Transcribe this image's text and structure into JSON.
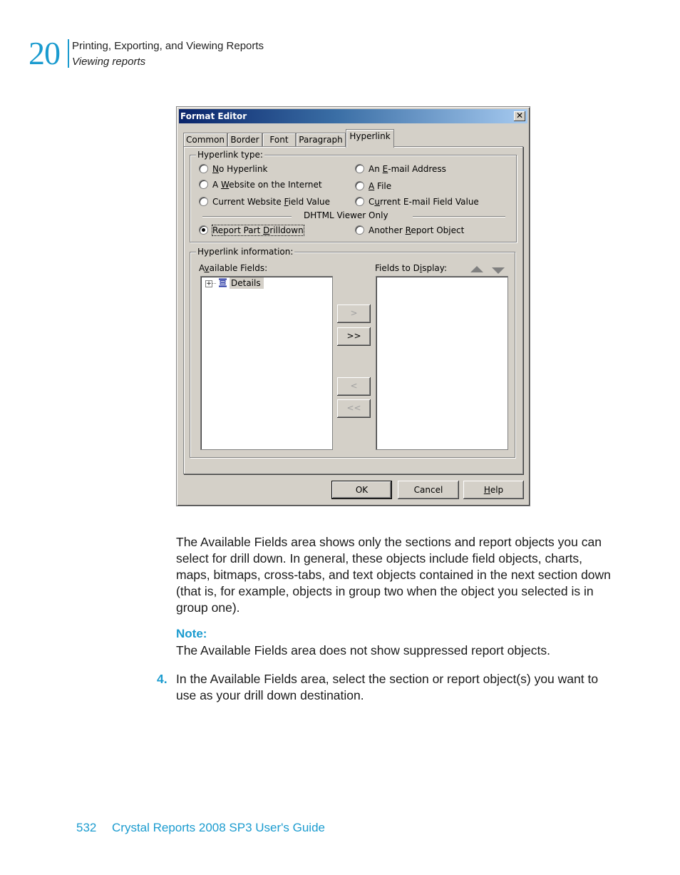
{
  "header": {
    "chapter_number": "20",
    "chapter_title": "Printing, Exporting, and Viewing Reports",
    "section_title": "Viewing reports"
  },
  "dialog": {
    "title": "Format Editor",
    "close_glyph": "✕",
    "tabs": [
      {
        "label": "Common",
        "active": false
      },
      {
        "label": "Border",
        "active": false
      },
      {
        "label": "Font",
        "active": false
      },
      {
        "label": "Paragraph",
        "active": false
      },
      {
        "label": "Hyperlink",
        "active": true
      }
    ],
    "hyperlink_type": {
      "legend": "Hyperlink type:",
      "options": [
        {
          "pre": "",
          "key": "N",
          "post": "o Hyperlink",
          "selected": false
        },
        {
          "pre": "An ",
          "key": "E",
          "post": "-mail Address",
          "selected": false
        },
        {
          "pre": "A ",
          "key": "W",
          "post": "ebsite on the Internet",
          "selected": false
        },
        {
          "pre": "",
          "key": "A",
          "post": " File",
          "selected": false
        },
        {
          "pre": "Current Website ",
          "key": "F",
          "post": "ield Value",
          "selected": false
        },
        {
          "pre": "C",
          "key": "u",
          "post": "rrent E-mail Field Value",
          "selected": false
        },
        {
          "pre": "Report Part ",
          "key": "D",
          "post": "rilldown",
          "selected": true
        },
        {
          "pre": "Another ",
          "key": "R",
          "post": "eport Object",
          "selected": false
        }
      ],
      "separator_label": "DHTML Viewer Only"
    },
    "hyperlink_info": {
      "legend": "Hyperlink information:",
      "available_fields": {
        "pre": "A",
        "key": "v",
        "post": "ailable Fields:"
      },
      "fields_to_display": {
        "pre": "Fields to D",
        "key": "i",
        "post": "splay:"
      },
      "tree_items": [
        {
          "label": "Details",
          "expander": "+"
        }
      ],
      "transfer_buttons": [
        {
          "label": ">",
          "enabled": false
        },
        {
          "label": ">>",
          "enabled": true
        },
        {
          "label": "<",
          "enabled": false
        },
        {
          "label": "<<",
          "enabled": false
        }
      ]
    },
    "buttons": {
      "ok": "OK",
      "cancel": "Cancel",
      "help_key": "H",
      "help_rest": "elp"
    }
  },
  "body": {
    "paragraph1": "The Available Fields area shows only the sections and report objects you can select for drill down. In general, these objects include field objects, charts, maps, bitmaps, cross-tabs, and text objects contained in the next section down (that is, for example, objects in group two when the object you selected is in group one).",
    "note_label": "Note:",
    "note_text": "The Available Fields area does not show suppressed report objects.",
    "step_number": "4.",
    "step_text": "In the Available Fields area, select the section or report object(s) you want to use as your drill down destination."
  },
  "footer": {
    "page_number": "532",
    "book_title": "Crystal Reports 2008 SP3 User's Guide"
  }
}
